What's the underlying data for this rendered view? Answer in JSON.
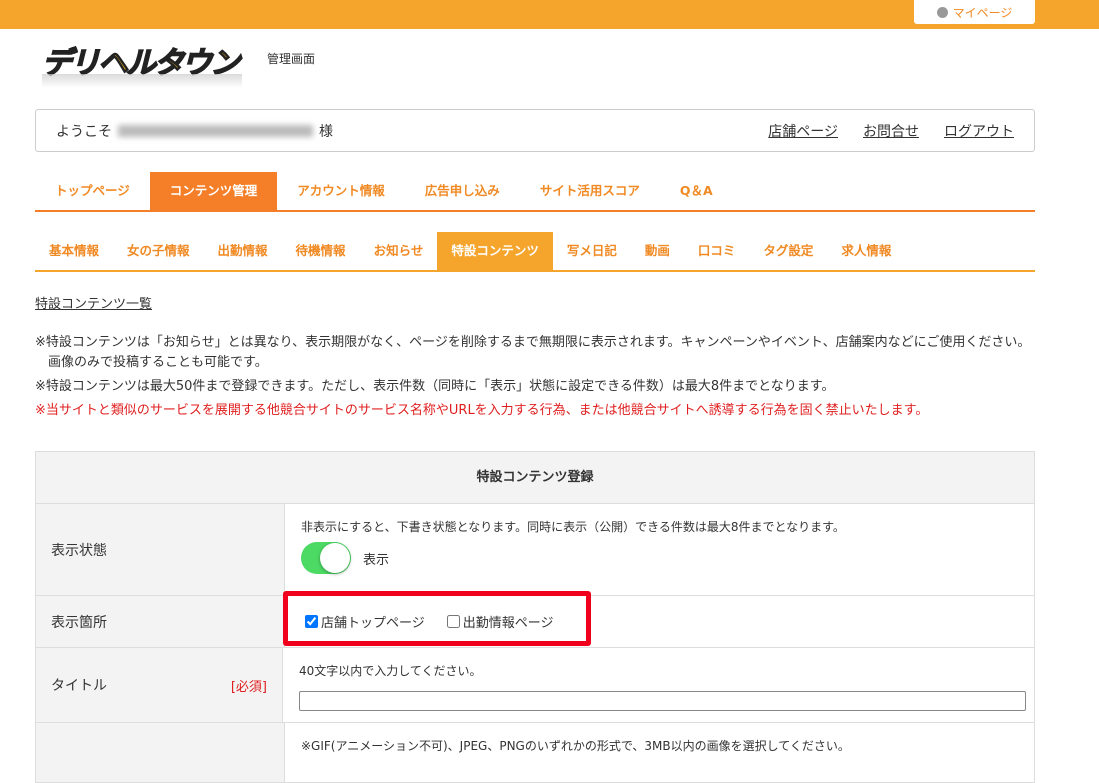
{
  "header": {
    "mypage": "マイページ",
    "logo_text": "デリヘルタウン",
    "admin_label": "管理画面"
  },
  "welcome": {
    "prefix": "ようこそ",
    "suffix": "様",
    "links": [
      "店舗ページ",
      "お問合せ",
      "ログアウト"
    ]
  },
  "main_nav": [
    {
      "label": "トップページ"
    },
    {
      "label": "コンテンツ管理",
      "active": true
    },
    {
      "label": "アカウント情報"
    },
    {
      "label": "広告申し込み"
    },
    {
      "label": "サイト活用スコア"
    },
    {
      "label": "Q＆A"
    }
  ],
  "sub_nav": [
    {
      "label": "基本情報"
    },
    {
      "label": "女の子情報"
    },
    {
      "label": "出勤情報"
    },
    {
      "label": "待機情報"
    },
    {
      "label": "お知らせ"
    },
    {
      "label": "特設コンテンツ",
      "active": true
    },
    {
      "label": "写メ日記"
    },
    {
      "label": "動画"
    },
    {
      "label": "口コミ"
    },
    {
      "label": "タグ設定"
    },
    {
      "label": "求人情報"
    }
  ],
  "list_link": "特設コンテンツ一覧",
  "notes": [
    "※特設コンテンツは「お知らせ」とは異なり、表示期限がなく、ページを削除するまで無期限に表示されます。キャンペーンやイベント、店舗案内などにご使用ください。画像のみで投稿することも可能です。",
    "※特設コンテンツは最大50件まで登録できます。ただし、表示件数（同時に「表示」状態に設定できる件数）は最大8件までとなります。"
  ],
  "warning": "※当サイトと類似のサービスを展開する他競合サイトのサービス名称やURLを入力する行為、または他競合サイトへ誘導する行為を固く禁止いたします。",
  "form": {
    "title": "特設コンテンツ登録",
    "status": {
      "label": "表示状態",
      "hint": "非表示にすると、下書き状態となります。同時に表示（公開）できる件数は最大8件までとなります。",
      "toggle_label": "表示",
      "on": true
    },
    "location": {
      "label": "表示箇所",
      "options": [
        {
          "label": "店舗トップページ",
          "checked": true
        },
        {
          "label": "出勤情報ページ",
          "checked": false
        }
      ]
    },
    "title_field": {
      "label": "タイトル",
      "required": "[必須]",
      "hint": "40文字以内で入力してください。",
      "value": ""
    },
    "image": {
      "hint": "※GIF(アニメーション不可)、JPEG、PNGのいずれかの形式で、3MB以内の画像を選択してください。"
    }
  },
  "colors": {
    "accent": "#f47f28",
    "topbar": "#f5a52b",
    "warning": "#e02020",
    "highlight": "#f0001c",
    "toggle": "#4cd964"
  }
}
